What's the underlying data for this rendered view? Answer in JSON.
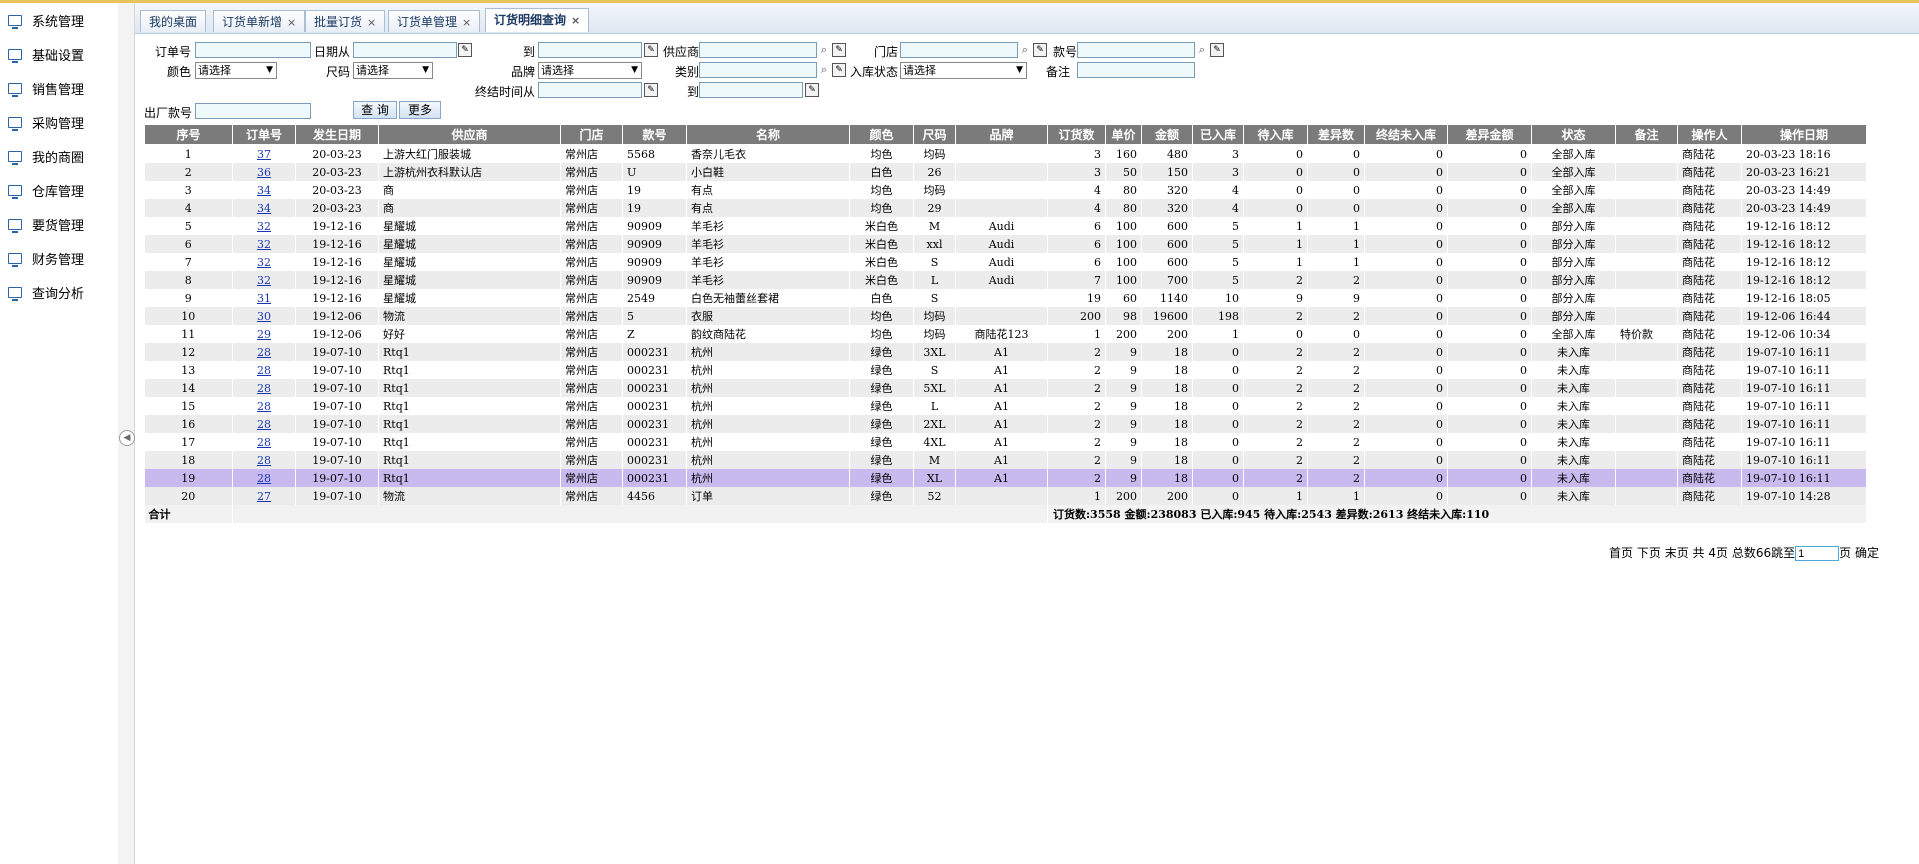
{
  "sidebar": {
    "items": [
      "系统管理",
      "基础设置",
      "销售管理",
      "采购管理",
      "我的商圈",
      "仓库管理",
      "要货管理",
      "财务管理",
      "查询分析"
    ]
  },
  "tabs": [
    {
      "label": "我的桌面",
      "closable": false
    },
    {
      "label": "订货单新增",
      "closable": true
    },
    {
      "label": "批量订货",
      "closable": true
    },
    {
      "label": "订货单管理",
      "closable": true
    },
    {
      "label": "订货明细查询",
      "closable": true,
      "active": true
    }
  ],
  "close_glyph": "×",
  "form": {
    "order_no": "订单号",
    "date_from": "日期从",
    "to": "到",
    "supplier": "供应商",
    "store": "门店",
    "style_no": "款号",
    "color": "颜色",
    "size": "尺码",
    "brand": "品牌",
    "category": "类别",
    "stock_status": "入库状态",
    "remark": "备注",
    "end_time_from": "终结时间从",
    "factory_no": "出厂款号",
    "select_placeholder": "请选择",
    "search_btn": "查 询",
    "more_btn": "更多"
  },
  "table": {
    "columns": [
      "序号",
      "订单号",
      "发生日期",
      "供应商",
      "门店",
      "款号",
      "名称",
      "颜色",
      "尺码",
      "品牌",
      "订货数",
      "单价",
      "金额",
      "已入库",
      "待入库",
      "差异数",
      "终结未入库",
      "差异金额",
      "状态",
      "备注",
      "操作人",
      "操作日期"
    ],
    "rows": [
      [
        "1",
        "37",
        "20-03-23",
        "上游大红门服装城",
        "常州店",
        "5568",
        "香奈儿毛衣",
        "均色",
        "均码",
        "",
        "3",
        "160",
        "480",
        "3",
        "0",
        "0",
        "0",
        "0",
        "全部入库",
        "",
        "商陆花",
        "20-03-23 18:16"
      ],
      [
        "2",
        "36",
        "20-03-23",
        "上游杭州衣科默认店",
        "常州店",
        "U",
        "小白鞋",
        "白色",
        "26",
        "",
        "3",
        "50",
        "150",
        "3",
        "0",
        "0",
        "0",
        "0",
        "全部入库",
        "",
        "商陆花",
        "20-03-23 16:21"
      ],
      [
        "3",
        "34",
        "20-03-23",
        "商",
        "常州店",
        "19",
        "有点",
        "均色",
        "均码",
        "",
        "4",
        "80",
        "320",
        "4",
        "0",
        "0",
        "0",
        "0",
        "全部入库",
        "",
        "商陆花",
        "20-03-23 14:49"
      ],
      [
        "4",
        "34",
        "20-03-23",
        "商",
        "常州店",
        "19",
        "有点",
        "均色",
        "29",
        "",
        "4",
        "80",
        "320",
        "4",
        "0",
        "0",
        "0",
        "0",
        "全部入库",
        "",
        "商陆花",
        "20-03-23 14:49"
      ],
      [
        "5",
        "32",
        "19-12-16",
        "星耀城",
        "常州店",
        "90909",
        "羊毛衫",
        "米白色",
        "M",
        "Audi",
        "6",
        "100",
        "600",
        "5",
        "1",
        "1",
        "0",
        "0",
        "部分入库",
        "",
        "商陆花",
        "19-12-16 18:12"
      ],
      [
        "6",
        "32",
        "19-12-16",
        "星耀城",
        "常州店",
        "90909",
        "羊毛衫",
        "米白色",
        "xxl",
        "Audi",
        "6",
        "100",
        "600",
        "5",
        "1",
        "1",
        "0",
        "0",
        "部分入库",
        "",
        "商陆花",
        "19-12-16 18:12"
      ],
      [
        "7",
        "32",
        "19-12-16",
        "星耀城",
        "常州店",
        "90909",
        "羊毛衫",
        "米白色",
        "S",
        "Audi",
        "6",
        "100",
        "600",
        "5",
        "1",
        "1",
        "0",
        "0",
        "部分入库",
        "",
        "商陆花",
        "19-12-16 18:12"
      ],
      [
        "8",
        "32",
        "19-12-16",
        "星耀城",
        "常州店",
        "90909",
        "羊毛衫",
        "米白色",
        "L",
        "Audi",
        "7",
        "100",
        "700",
        "5",
        "2",
        "2",
        "0",
        "0",
        "部分入库",
        "",
        "商陆花",
        "19-12-16 18:12"
      ],
      [
        "9",
        "31",
        "19-12-16",
        "星耀城",
        "常州店",
        "2549",
        "白色无袖蕾丝套裙",
        "白色",
        "S",
        "",
        "19",
        "60",
        "1140",
        "10",
        "9",
        "9",
        "0",
        "0",
        "部分入库",
        "",
        "商陆花",
        "19-12-16 18:05"
      ],
      [
        "10",
        "30",
        "19-12-06",
        "物流",
        "常州店",
        "5",
        "衣服",
        "均色",
        "均码",
        "",
        "200",
        "98",
        "19600",
        "198",
        "2",
        "2",
        "0",
        "0",
        "部分入库",
        "",
        "商陆花",
        "19-12-06 16:44"
      ],
      [
        "11",
        "29",
        "19-12-06",
        "好好",
        "常州店",
        "Z",
        "韵纹商陆花",
        "均色",
        "均码",
        "商陆花123",
        "1",
        "200",
        "200",
        "1",
        "0",
        "0",
        "0",
        "0",
        "全部入库",
        "特价款",
        "商陆花",
        "19-12-06 10:34"
      ],
      [
        "12",
        "28",
        "19-07-10",
        "Rtq1",
        "常州店",
        "000231",
        "杭州",
        "绿色",
        "3XL",
        "A1",
        "2",
        "9",
        "18",
        "0",
        "2",
        "2",
        "0",
        "0",
        "未入库",
        "",
        "商陆花",
        "19-07-10 16:11"
      ],
      [
        "13",
        "28",
        "19-07-10",
        "Rtq1",
        "常州店",
        "000231",
        "杭州",
        "绿色",
        "S",
        "A1",
        "2",
        "9",
        "18",
        "0",
        "2",
        "2",
        "0",
        "0",
        "未入库",
        "",
        "商陆花",
        "19-07-10 16:11"
      ],
      [
        "14",
        "28",
        "19-07-10",
        "Rtq1",
        "常州店",
        "000231",
        "杭州",
        "绿色",
        "5XL",
        "A1",
        "2",
        "9",
        "18",
        "0",
        "2",
        "2",
        "0",
        "0",
        "未入库",
        "",
        "商陆花",
        "19-07-10 16:11"
      ],
      [
        "15",
        "28",
        "19-07-10",
        "Rtq1",
        "常州店",
        "000231",
        "杭州",
        "绿色",
        "L",
        "A1",
        "2",
        "9",
        "18",
        "0",
        "2",
        "2",
        "0",
        "0",
        "未入库",
        "",
        "商陆花",
        "19-07-10 16:11"
      ],
      [
        "16",
        "28",
        "19-07-10",
        "Rtq1",
        "常州店",
        "000231",
        "杭州",
        "绿色",
        "2XL",
        "A1",
        "2",
        "9",
        "18",
        "0",
        "2",
        "2",
        "0",
        "0",
        "未入库",
        "",
        "商陆花",
        "19-07-10 16:11"
      ],
      [
        "17",
        "28",
        "19-07-10",
        "Rtq1",
        "常州店",
        "000231",
        "杭州",
        "绿色",
        "4XL",
        "A1",
        "2",
        "9",
        "18",
        "0",
        "2",
        "2",
        "0",
        "0",
        "未入库",
        "",
        "商陆花",
        "19-07-10 16:11"
      ],
      [
        "18",
        "28",
        "19-07-10",
        "Rtq1",
        "常州店",
        "000231",
        "杭州",
        "绿色",
        "M",
        "A1",
        "2",
        "9",
        "18",
        "0",
        "2",
        "2",
        "0",
        "0",
        "未入库",
        "",
        "商陆花",
        "19-07-10 16:11"
      ],
      [
        "19",
        "28",
        "19-07-10",
        "Rtq1",
        "常州店",
        "000231",
        "杭州",
        "绿色",
        "XL",
        "A1",
        "2",
        "9",
        "18",
        "0",
        "2",
        "2",
        "0",
        "0",
        "未入库",
        "",
        "商陆花",
        "19-07-10 16:11"
      ],
      [
        "20",
        "27",
        "19-07-10",
        "物流",
        "常州店",
        "4456",
        "订单",
        "绿色",
        "52",
        "",
        "1",
        "200",
        "200",
        "0",
        "1",
        "1",
        "0",
        "0",
        "未入库",
        "",
        "商陆花",
        "19-07-10 14:28"
      ]
    ],
    "selected_row": 19,
    "total_label": "合计",
    "total_text": "订货数:3558 金额:238083 已入库:945 待入库:2543 差异数:2613 终结未入库:110"
  },
  "pager": {
    "first": "首页",
    "next": "下页",
    "last": "末页",
    "total_pages_text": "共 4页",
    "total_count_text": "总数66",
    "jump_label": "跳至",
    "page_input": "1",
    "page_unit": "页",
    "confirm": "确定"
  },
  "colors": {
    "header_bg": "#7b7b7b",
    "selected_row": "#c8b9ee",
    "accent": "#e8c25a",
    "link": "#1a37b3"
  },
  "icons": {
    "sidebar": "monitor-icon",
    "date_picker": "pencil-icon",
    "lookup": "magnifier-icon",
    "collapse": "chevron-left-icon"
  }
}
